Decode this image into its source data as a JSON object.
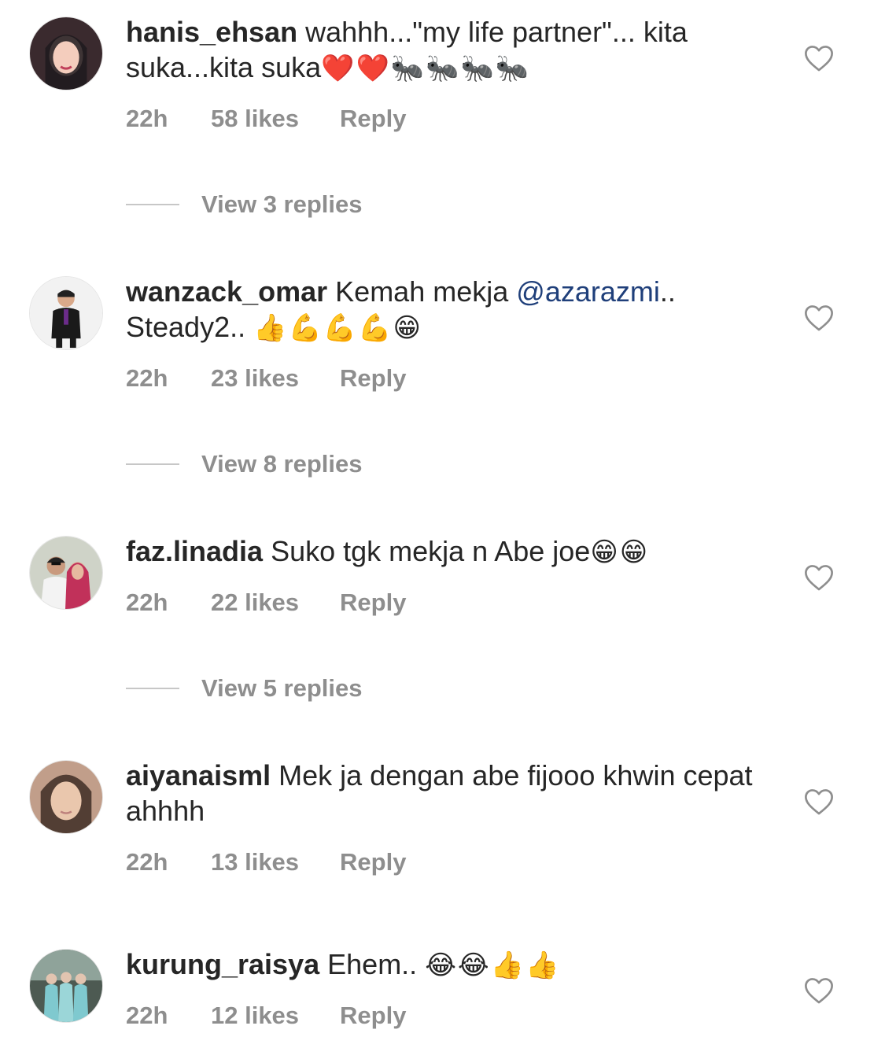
{
  "comments": [
    {
      "username": "hanis_ehsan",
      "text": "wahhh...\"my life partner\"... kita suka...kita suka",
      "emoji": "❤️❤️🐜🐜🐜🐜",
      "time": "22h",
      "likes": "58 likes",
      "reply": "Reply",
      "view_replies": "View 3 replies"
    },
    {
      "username": "wanzack_omar",
      "text": "Kemah mekja",
      "mention": "@azarazmi",
      "text_after": ".. Steady2..",
      "emoji": "👍💪💪💪😁",
      "time": "22h",
      "likes": "23 likes",
      "reply": "Reply",
      "view_replies": "View 8 replies"
    },
    {
      "username": "faz.linadia",
      "text": "Suko tgk mekja n Abe joe",
      "emoji": "😁😁",
      "time": "22h",
      "likes": "22 likes",
      "reply": "Reply",
      "view_replies": "View 5 replies"
    },
    {
      "username": "aiyanaisml",
      "text": "Mek ja dengan abe fijooo khwin cepat ahhhh",
      "emoji": "",
      "time": "22h",
      "likes": "13 likes",
      "reply": "Reply"
    },
    {
      "username": "kurung_raisya",
      "text": "Ehem..",
      "emoji": "😂😂👍👍",
      "time": "22h",
      "likes": "12 likes",
      "reply": "Reply"
    }
  ],
  "colors": {
    "text": "#262626",
    "meta": "#8e8e8e",
    "mention": "#1f3f7a",
    "divider": "#c7c7c7"
  },
  "icons": {
    "like": "heart-outline-icon"
  }
}
